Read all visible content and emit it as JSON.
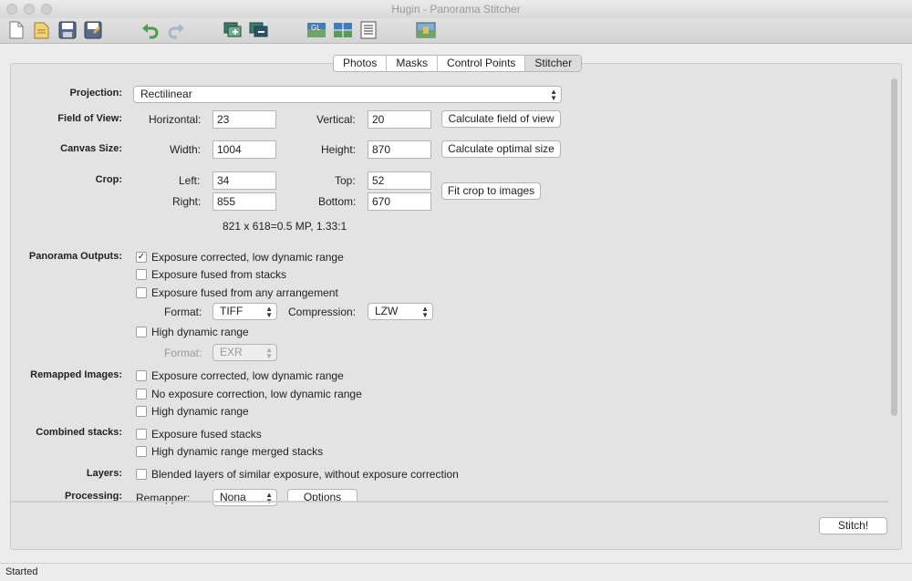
{
  "window": {
    "title": "Hugin - Panorama Stitcher"
  },
  "toolbar": {
    "icons": [
      "new-project-icon",
      "open-project-icon",
      "save-icon",
      "save-as-icon",
      "undo-icon",
      "redo-icon",
      "add-images-icon",
      "add-images-series-icon",
      "gl-preview-icon",
      "preview-panorama-icon",
      "control-points-table-icon",
      "layout-icon"
    ]
  },
  "tabs": [
    {
      "label": "Photos",
      "active": false
    },
    {
      "label": "Masks",
      "active": false
    },
    {
      "label": "Control Points",
      "active": false
    },
    {
      "label": "Stitcher",
      "active": true
    }
  ],
  "stitcher": {
    "projection": {
      "label": "Projection:",
      "value": "Rectilinear"
    },
    "fov": {
      "label": "Field of View:",
      "h_label": "Horizontal:",
      "h_value": "23",
      "v_label": "Vertical:",
      "v_value": "20",
      "button": "Calculate field of view"
    },
    "canvas": {
      "label": "Canvas Size:",
      "w_label": "Width:",
      "w_value": "1004",
      "h_label": "Height:",
      "h_value": "870",
      "button": "Calculate optimal size"
    },
    "crop": {
      "label": "Crop:",
      "left_label": "Left:",
      "left_value": "34",
      "top_label": "Top:",
      "top_value": "52",
      "right_label": "Right:",
      "right_value": "855",
      "bottom_label": "Bottom:",
      "bottom_value": "670",
      "button": "Fit crop to images",
      "info": "821 x 618=0.5 MP, 1.33:1"
    },
    "outputs": {
      "label": "Panorama Outputs:",
      "opt1": "Exposure corrected, low dynamic range",
      "opt2": "Exposure fused from stacks",
      "opt3": "Exposure fused from any arrangement",
      "format_label": "Format:",
      "format_value": "TIFF",
      "compression_label": "Compression:",
      "compression_value": "LZW",
      "opt4": "High dynamic range",
      "hdr_format_label": "Format:",
      "hdr_format_value": "EXR"
    },
    "remapped": {
      "label": "Remapped Images:",
      "opt1": "Exposure corrected, low dynamic range",
      "opt2": "No exposure correction, low dynamic range",
      "opt3": "High dynamic range"
    },
    "stacks": {
      "label": "Combined stacks:",
      "opt1": "Exposure fused stacks",
      "opt2": "High dynamic range merged stacks"
    },
    "layers": {
      "label": "Layers:",
      "opt1": "Blended layers of similar exposure, without exposure correction"
    },
    "processing": {
      "label": "Processing:",
      "remapper_label": "Remapper:",
      "remapper_value": "Nona",
      "options_button": "Options"
    }
  },
  "stitch_button": "Stitch!",
  "status": "Started"
}
